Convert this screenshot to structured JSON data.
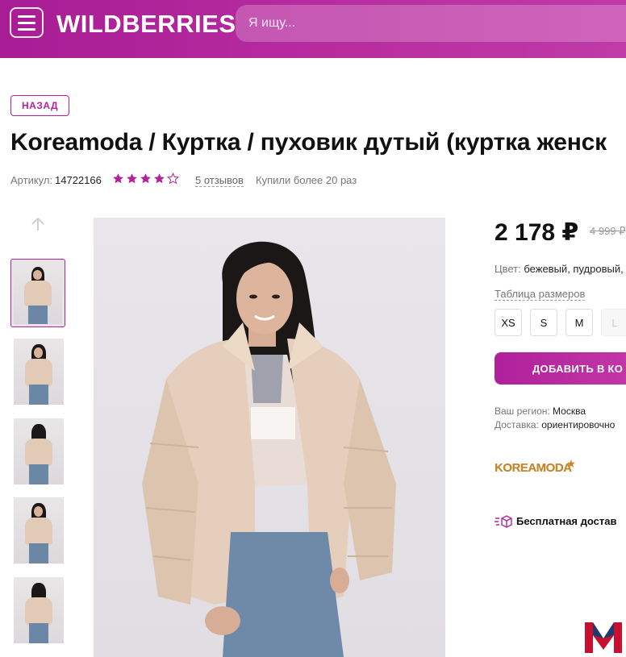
{
  "header": {
    "logo": "WILDBERRIES",
    "search_placeholder": "Я ищу...",
    "menu_icon": "hamburger-icon",
    "colors": {
      "brand": "#b4219c"
    }
  },
  "back_label": "НАЗАД",
  "product": {
    "title": "Koreamoda / Куртка / пуховик дутый (куртка женск",
    "article_label": "Артикул:",
    "article_value": "14722166",
    "rating_stars": 4,
    "rating_max": 5,
    "reviews": "5 отзывов",
    "bought": "Купили более 20 раз"
  },
  "gallery": {
    "thumbnail_count": 5,
    "active_thumbnail": 0
  },
  "pricing": {
    "price": "2 178 ₽",
    "old_price": "4 999 ₽"
  },
  "details": {
    "color_label": "Цвет:",
    "color_value": "бежевый, пудровый, п",
    "size_table": "Таблица размеров",
    "sizes": [
      "XS",
      "S",
      "M",
      "L"
    ],
    "sizes_available": [
      "XS",
      "S",
      "M"
    ],
    "add_to_cart": "ДОБАВИТЬ В КО",
    "region_label": "Ваш регион:",
    "region_value": "Москва",
    "delivery_label": "Доставка:",
    "delivery_value": "ориентировочно"
  },
  "brand": {
    "logo_text": "KOREAMODA"
  },
  "shipping": {
    "free_delivery": "Бесплатная достав"
  }
}
